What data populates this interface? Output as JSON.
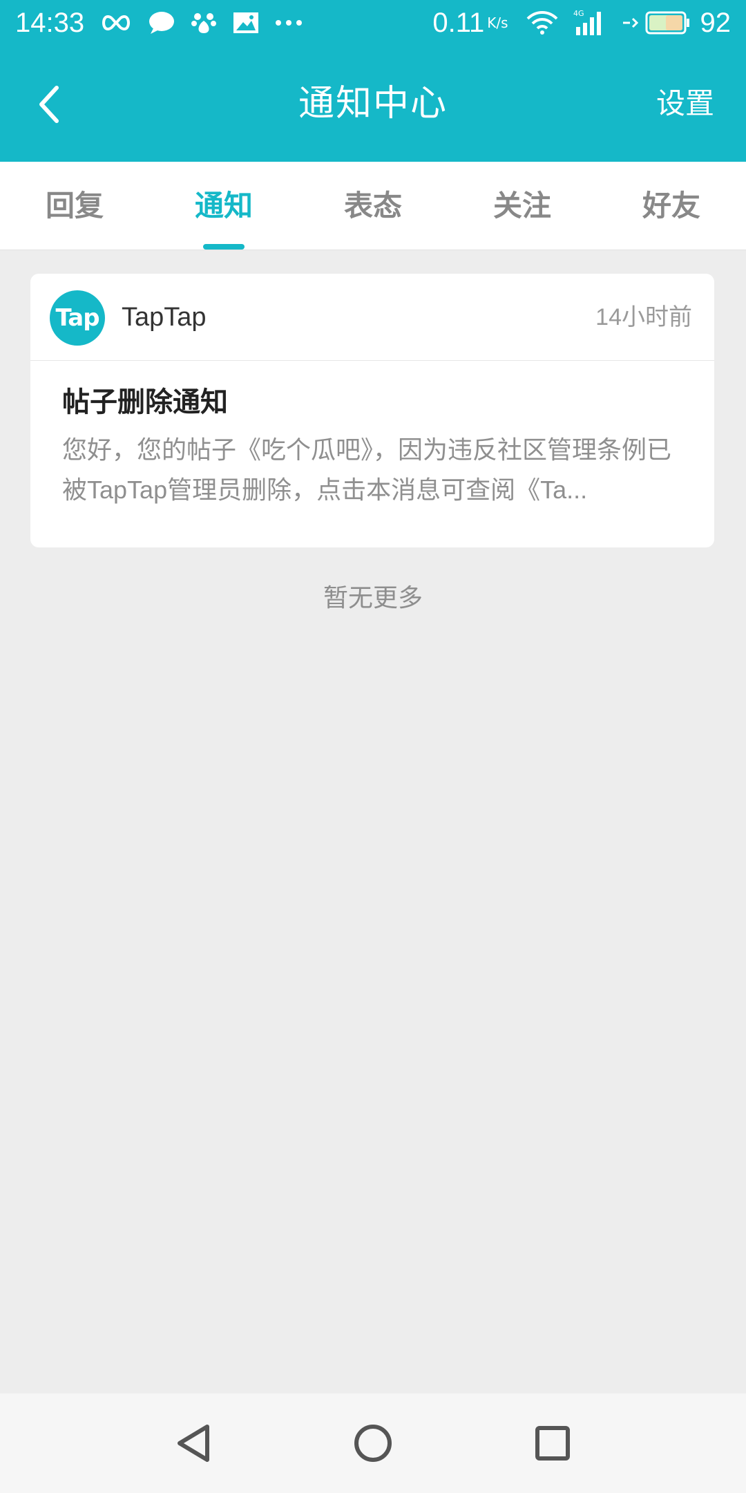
{
  "status_bar": {
    "time": "14:33",
    "net_speed": "0.11",
    "net_unit": "K/s",
    "battery": "92",
    "icons": [
      "infinity-icon",
      "chat-bubble-icon",
      "baidu-paw-icon",
      "image-icon",
      "more-dots-icon",
      "wifi-icon",
      "signal-4g-icon",
      "charging-icon",
      "battery-icon"
    ]
  },
  "app_bar": {
    "title": "通知中心",
    "settings_label": "设置",
    "back_icon": "chevron-left-icon"
  },
  "tabs": [
    {
      "label": "回复",
      "active": false
    },
    {
      "label": "通知",
      "active": true
    },
    {
      "label": "表态",
      "active": false
    },
    {
      "label": "关注",
      "active": false
    },
    {
      "label": "好友",
      "active": false
    }
  ],
  "notification": {
    "avatar_text": "Tap",
    "sender": "TapTap",
    "time": "14小时前",
    "title": "帖子删除通知",
    "body": "您好，您的帖子《吃个瓜吧》，因为违反社区管理条例已被TapTap管理员删除，点击本消息可查阅《Ta..."
  },
  "footer_text": "暂无更多",
  "nav_bar": {
    "icons": [
      "back-triangle-icon",
      "home-circle-icon",
      "recents-square-icon"
    ]
  },
  "colors": {
    "primary": "#15b8c8",
    "background": "#ededed",
    "card": "#ffffff",
    "muted_text": "#8f8f8f"
  }
}
